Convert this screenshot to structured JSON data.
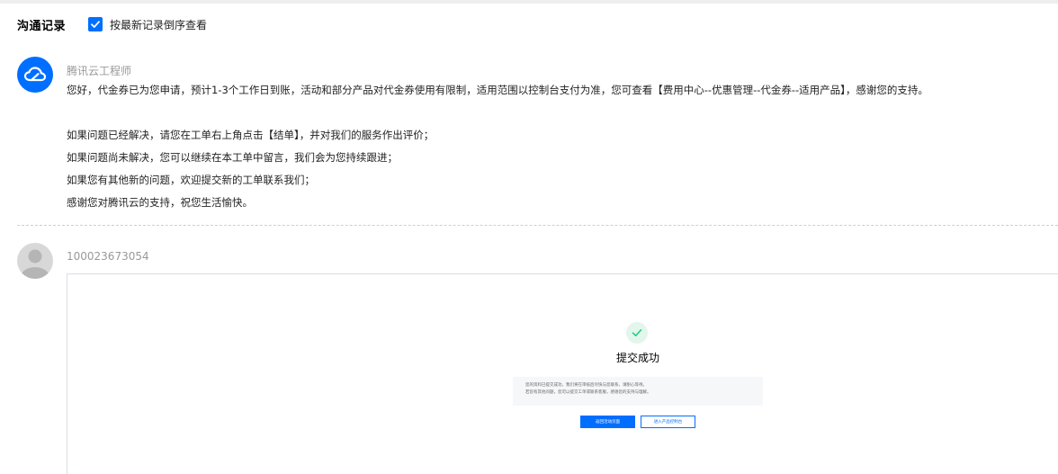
{
  "header": {
    "title": "沟通记录",
    "sort_label": "按最新记录倒序查看",
    "sort_checked": true
  },
  "messages": [
    {
      "author": "腾讯云工程师",
      "avatar_icon": "cloud-logo-icon",
      "lines": [
        "您好，代金券已为您申请，预计1-3个工作日到账，活动和部分产品对代金券使用有限制，适用范围以控制台支付为准，您可查看【费用中心--优惠管理--代金券--适用产品】，感谢您的支持。",
        "",
        "如果问题已经解决，请您在工单右上角点击【结单】，并对我们的服务作出评价；",
        "如果问题尚未解决，您可以继续在本工单中留言，我们会为您持续跟进；",
        "如果您有其他新的问题，欢迎提交新的工单联系我们；",
        "感谢您对腾讯云的支持，祝您生活愉快。"
      ]
    },
    {
      "author": "100023673054",
      "avatar_icon": "default-user-avatar-icon",
      "attachment": {
        "success_title": "提交成功",
        "notice_lines": [
          "您的资料已提交成功，我们将在审核后尽快与您联系，请耐心等待。",
          "若您有其他问题，您可以提交工单或联系客服，感谢您的支持与理解。"
        ],
        "primary_button": "返回活动页面",
        "secondary_button": "进入产品控制台"
      }
    }
  ],
  "colors": {
    "brand": "#006eff",
    "success": "#29cc85",
    "muted_text": "#999999"
  }
}
